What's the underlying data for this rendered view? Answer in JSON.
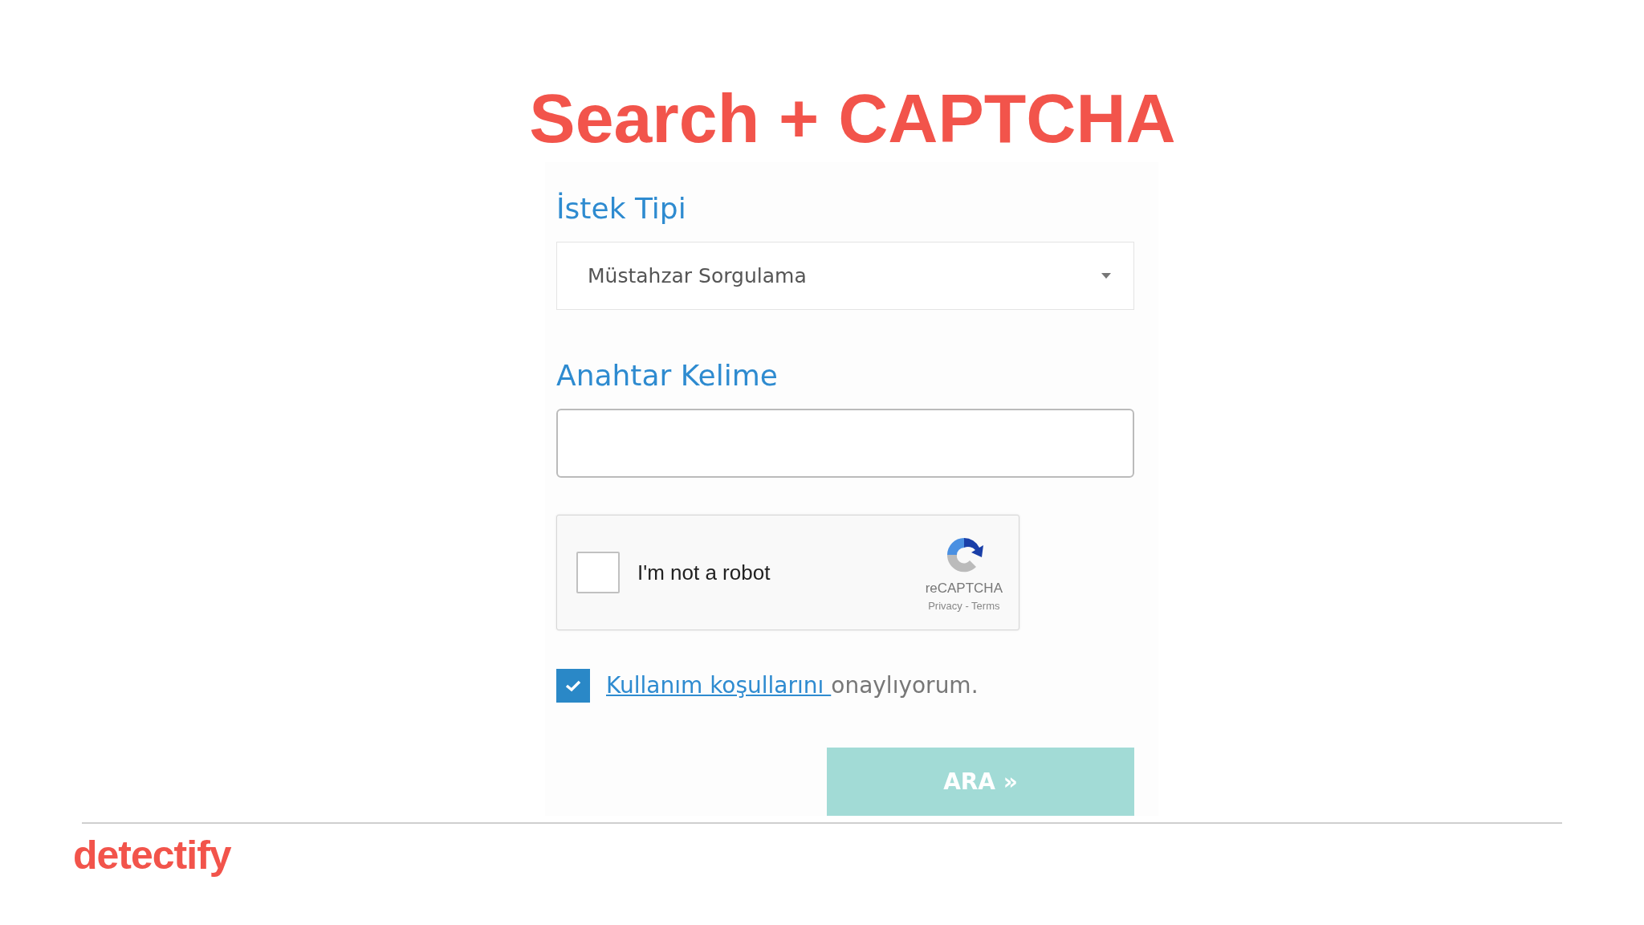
{
  "title": "Search + CAPTCHA",
  "form": {
    "request_type": {
      "label": "İstek Tipi",
      "value": "Müstahzar Sorgulama"
    },
    "keyword": {
      "label": "Anahtar Kelime"
    },
    "captcha": {
      "checked": false,
      "label": "I'm not a robot",
      "brand": "reCAPTCHA",
      "links": "Privacy - Terms"
    },
    "terms": {
      "checked": true,
      "link": "Kullanım koşullarını",
      "text": "onaylıyorum."
    },
    "submit": "ARA »"
  },
  "footer": {
    "logo": "detectify"
  }
}
